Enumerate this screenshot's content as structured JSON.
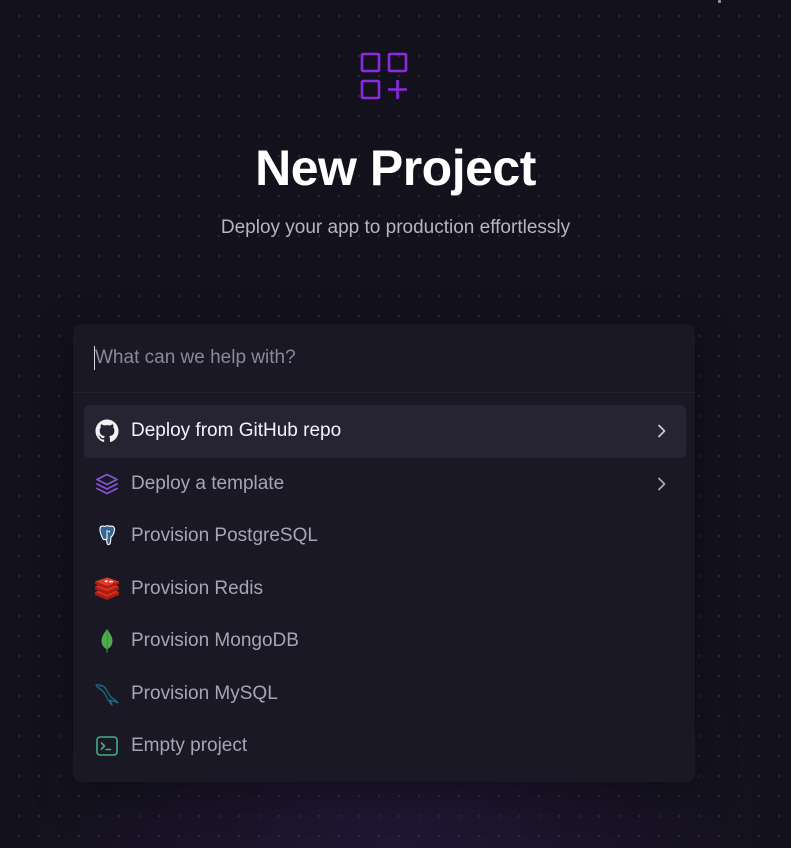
{
  "header": {
    "logo_icon": "grid-plus-icon",
    "title": "New Project",
    "subtitle": "Deploy your app to production effortlessly"
  },
  "search": {
    "placeholder": "What can we help with?",
    "value": ""
  },
  "menu": {
    "items": [
      {
        "label": "Deploy from GitHub repo",
        "icon": "github-icon",
        "has_chevron": true,
        "active": true
      },
      {
        "label": "Deploy a template",
        "icon": "layers-icon",
        "has_chevron": true,
        "active": false
      },
      {
        "label": "Provision PostgreSQL",
        "icon": "postgresql-icon",
        "has_chevron": false,
        "active": false
      },
      {
        "label": "Provision Redis",
        "icon": "redis-icon",
        "has_chevron": false,
        "active": false
      },
      {
        "label": "Provision MongoDB",
        "icon": "mongodb-icon",
        "has_chevron": false,
        "active": false
      },
      {
        "label": "Provision MySQL",
        "icon": "mysql-icon",
        "has_chevron": false,
        "active": false
      },
      {
        "label": "Empty project",
        "icon": "terminal-icon",
        "has_chevron": false,
        "active": false
      }
    ]
  },
  "colors": {
    "background": "#13111c",
    "panel": "#1a1824",
    "accent_purple": "#8a2be2",
    "active_row": "#262433",
    "redis_red": "#d82c20",
    "mongodb_green": "#4fa94d",
    "terminal_green": "#3fae85"
  }
}
